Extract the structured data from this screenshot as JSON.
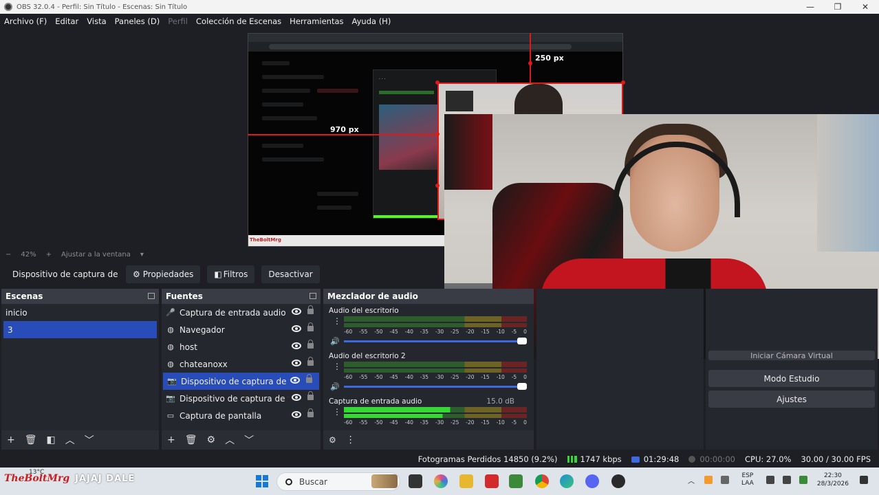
{
  "window": {
    "title": "OBS 32.0.4 - Perfil: Sin Título - Escenas: Sin Título",
    "minimize": "—",
    "restore": "❐",
    "close": "✕"
  },
  "menu": [
    {
      "label": "Archivo (F)",
      "disabled": false
    },
    {
      "label": "Editar",
      "disabled": false
    },
    {
      "label": "Vista",
      "disabled": false
    },
    {
      "label": "Paneles (D)",
      "disabled": false
    },
    {
      "label": "Perfil",
      "disabled": true
    },
    {
      "label": "Colección de Escenas",
      "disabled": false
    },
    {
      "label": "Herramientas",
      "disabled": false
    },
    {
      "label": "Ayuda (H)",
      "disabled": false
    }
  ],
  "preview": {
    "measure_top": "250 px",
    "measure_left": "970 px",
    "zoom_minus": "−",
    "zoom_value": "42%",
    "zoom_plus": "+",
    "fit_label": "Ajustar a la ventana",
    "fit_arrow": "▾",
    "minitaskbar_logo": "TheBoltMrg"
  },
  "source_toolbar": {
    "selected_source": "Dispositivo de captura de vídeo",
    "properties": "Propiedades",
    "filters": "Filtros",
    "deactivate": "Desactivar"
  },
  "scenes": {
    "title": "Escenas",
    "items": [
      {
        "label": "inicio",
        "selected": false
      },
      {
        "label": "3",
        "selected": true
      }
    ]
  },
  "sources": {
    "title": "Fuentes",
    "items": [
      {
        "label": "Captura de entrada audio",
        "icon": "microphone-icon",
        "glyph": "🎤",
        "selected": false
      },
      {
        "label": "Navegador",
        "icon": "globe-icon",
        "glyph": "◍",
        "selected": false
      },
      {
        "label": "host",
        "icon": "globe-icon",
        "glyph": "◍",
        "selected": false
      },
      {
        "label": "chateanoxx",
        "icon": "globe-icon",
        "glyph": "◍",
        "selected": false
      },
      {
        "label": "Dispositivo de captura de vídeo",
        "icon": "camera-icon",
        "glyph": "📷",
        "selected": true
      },
      {
        "label": "Dispositivo de captura de vídeo",
        "icon": "camera-icon",
        "glyph": "📷",
        "selected": false
      },
      {
        "label": "Captura de pantalla",
        "icon": "monitor-icon",
        "glyph": "▭",
        "selected": false
      }
    ]
  },
  "mixer": {
    "title": "Mezclador de audio",
    "channels": [
      {
        "name": "Audio del escritorio",
        "level": "",
        "active": false
      },
      {
        "name": "Audio del escritorio 2",
        "level": "",
        "active": false
      },
      {
        "name": "Captura de entrada audio",
        "level": "15.0 dB",
        "active": true
      }
    ],
    "ticks": [
      "-60",
      "-55",
      "-50",
      "-45",
      "-40",
      "-35",
      "-30",
      "-25",
      "-20",
      "-15",
      "-10",
      "-5",
      "0"
    ]
  },
  "controls": {
    "partial": "Iniciar Cámara Virtual",
    "studio_mode": "Modo Estudio",
    "settings": "Ajustes"
  },
  "status": {
    "dropped_frames": "Fotogramas Perdidos 14850 (9.2%)",
    "bitrate": "1747 kbps",
    "stream_time": "01:29:48",
    "rec_time": "00:00:00",
    "cpu": "CPU: 27.0%",
    "fps": "30.00 / 30.00 FPS"
  },
  "taskbar": {
    "logo": "TheBoltMrg",
    "temperature": "13°C",
    "ticker": "JAJAJ DALE",
    "search": "Buscar",
    "lang_top": "ESP",
    "lang_bottom": "LAA",
    "time": "22:30",
    "date": "28/3/2026"
  },
  "colors": {
    "accent_selected": "#284cb8",
    "guide_red": "#e01818",
    "meter_green": "#35d835"
  }
}
